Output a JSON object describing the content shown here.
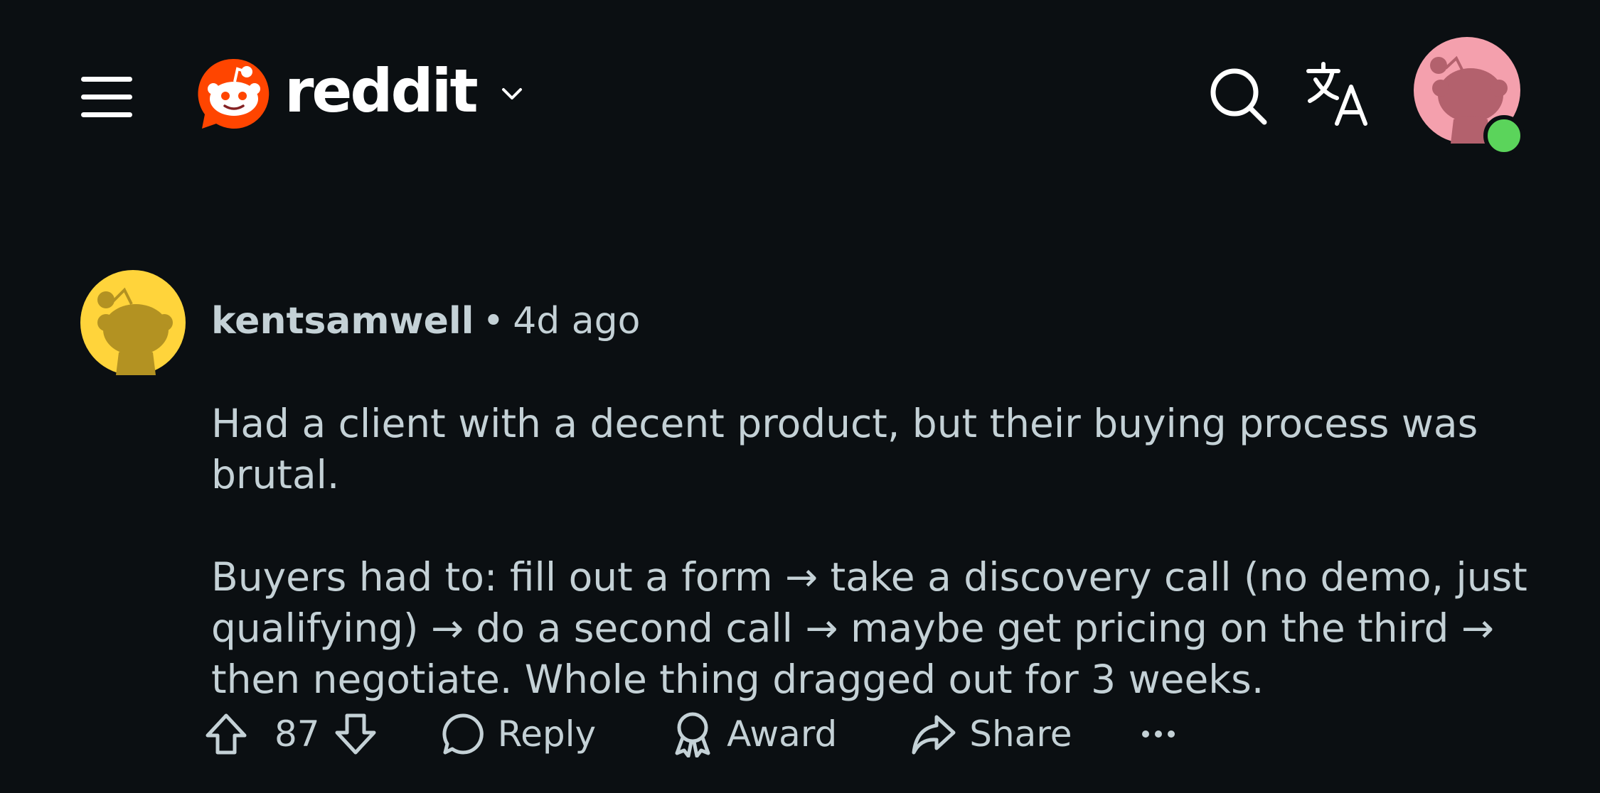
{
  "header": {
    "brand": "reddit",
    "icons": [
      "menu-icon",
      "reddit-snoo-icon",
      "chevron-down-icon",
      "search-icon",
      "translate-icon",
      "user-avatar"
    ],
    "accent_color": "#ff4500",
    "avatar_bg": "#f4a0ad",
    "online_color": "#5bd45b"
  },
  "comment": {
    "author": "kentsamwell",
    "separator": "•",
    "timestamp": "4d ago",
    "avatar_bg": "#ffd43b",
    "paragraphs": [
      "Had a client with a decent product, but their buying process was brutal.",
      "Buyers had to: fill out a form → take a discovery call (no demo, just qualifying) → do a second call → maybe get pricing on the third → then negotiate. Whole thing dragged out for 3 weeks."
    ],
    "actions": {
      "score": "87",
      "reply": "Reply",
      "award": "Award",
      "share": "Share"
    }
  }
}
